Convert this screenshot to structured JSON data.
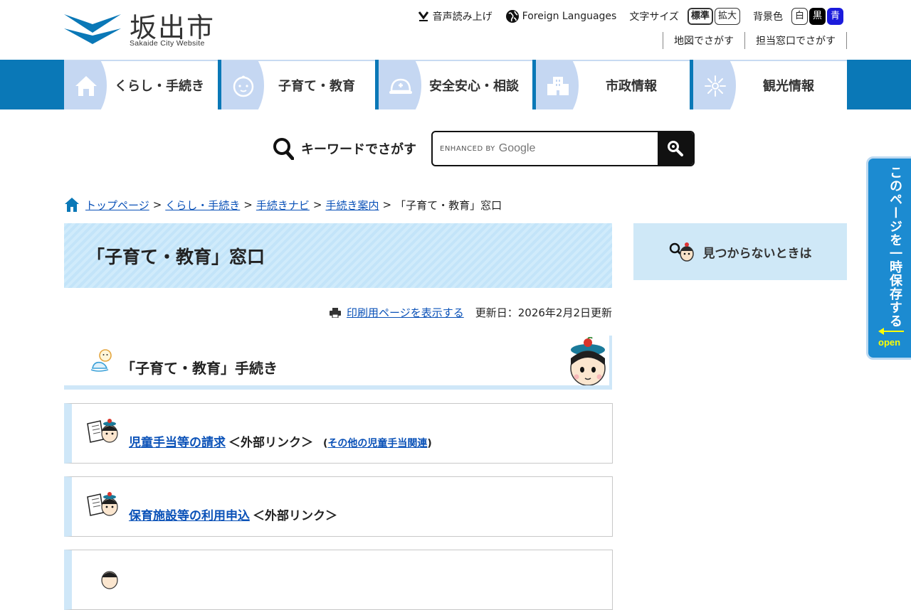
{
  "header": {
    "logo_jp": "坂出市",
    "logo_en": "Sakaide City Website",
    "utility": {
      "voice": "音声読み上げ",
      "foreign": "Foreign Languages",
      "font_size_label": "文字サイズ",
      "font_standard": "標準",
      "font_large": "拡大",
      "bg_color_label": "背景色",
      "bg_white": "白",
      "bg_black": "黒",
      "bg_blue": "青"
    },
    "sub_links": [
      "地図でさがす",
      "担当窓口でさがす"
    ]
  },
  "global_nav": [
    {
      "label": "くらし・手続き",
      "icon": "house-icon"
    },
    {
      "label": "子育て・教育",
      "icon": "baby-face-icon"
    },
    {
      "label": "安全安心・相談",
      "icon": "helmet-icon"
    },
    {
      "label": "市政情報",
      "icon": "building-icon"
    },
    {
      "label": "観光情報",
      "icon": "firework-icon"
    }
  ],
  "search": {
    "label": "キーワードでさがす",
    "placeholder_prefix": "ENHANCED BY",
    "placeholder_brand": "Google"
  },
  "breadcrumb": {
    "items": [
      "トップページ",
      "くらし・手続き",
      "手続きナビ",
      "手続き案内"
    ],
    "current": "「子育て・教育」窓口",
    "separator": ">"
  },
  "page": {
    "title": "「子育て・教育」窓口",
    "print_link": "印刷用ページを表示する",
    "updated": "更新日：2026年2月2日更新"
  },
  "sidebar": {
    "not_found": "見つからないときは"
  },
  "section": {
    "heading": "「子育て・教育」手続き"
  },
  "cards": [
    {
      "link": "児童手当等の請求",
      "ext": "＜外部リンク＞",
      "extra_open": "(",
      "extra_link": "その他の児童手当関連",
      "extra_close": ")"
    },
    {
      "link": "保育施設等の利用申込",
      "ext": "＜外部リンク＞"
    }
  ],
  "float_tab": {
    "text": "このページを一時保存する",
    "open": "open"
  },
  "colors": {
    "nav_blue": "#0a78b7",
    "light_blue": "#cfe8f7",
    "link": "#0b52b8",
    "float_tab": "#1c8bd1"
  }
}
